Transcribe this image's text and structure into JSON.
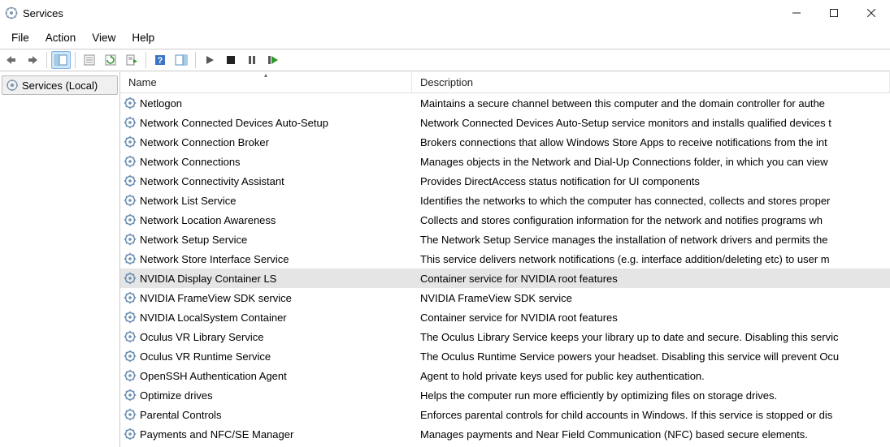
{
  "window": {
    "title": "Services"
  },
  "menubar": [
    "File",
    "Action",
    "View",
    "Help"
  ],
  "toolbar": [
    {
      "name": "nav-back-icon"
    },
    {
      "name": "nav-forward-icon"
    },
    {
      "sep": true
    },
    {
      "name": "show-hide-tree-icon",
      "active": true
    },
    {
      "sep": true
    },
    {
      "name": "properties-icon"
    },
    {
      "name": "refresh-icon"
    },
    {
      "name": "export-list-icon"
    },
    {
      "sep": true
    },
    {
      "name": "help-icon"
    },
    {
      "name": "show-hide-actions-icon"
    },
    {
      "sep": true
    },
    {
      "name": "start-service-icon"
    },
    {
      "name": "stop-service-icon"
    },
    {
      "name": "pause-service-icon"
    },
    {
      "name": "restart-service-icon"
    }
  ],
  "tree": {
    "root_label": "Services (Local)"
  },
  "columns": {
    "name": "Name",
    "description": "Description"
  },
  "selected_index": 9,
  "services": [
    {
      "name": "Netlogon",
      "desc": "Maintains a secure channel between this computer and the domain controller for authe"
    },
    {
      "name": "Network Connected Devices Auto-Setup",
      "desc": "Network Connected Devices Auto-Setup service monitors and installs qualified devices t"
    },
    {
      "name": "Network Connection Broker",
      "desc": "Brokers connections that allow Windows Store Apps to receive notifications from the int"
    },
    {
      "name": "Network Connections",
      "desc": "Manages objects in the Network and Dial-Up Connections folder, in which you can view"
    },
    {
      "name": "Network Connectivity Assistant",
      "desc": "Provides DirectAccess status notification for UI components"
    },
    {
      "name": "Network List Service",
      "desc": "Identifies the networks to which the computer has connected, collects and stores proper"
    },
    {
      "name": "Network Location Awareness",
      "desc": "Collects and stores configuration information for the network and notifies programs wh"
    },
    {
      "name": "Network Setup Service",
      "desc": "The Network Setup Service manages the installation of network drivers and permits the"
    },
    {
      "name": "Network Store Interface Service",
      "desc": "This service delivers network notifications (e.g. interface addition/deleting etc) to user m"
    },
    {
      "name": "NVIDIA Display Container LS",
      "desc": "Container service for NVIDIA root features"
    },
    {
      "name": "NVIDIA FrameView SDK service",
      "desc": "NVIDIA FrameView SDK service"
    },
    {
      "name": "NVIDIA LocalSystem Container",
      "desc": "Container service for NVIDIA root features"
    },
    {
      "name": "Oculus VR Library Service",
      "desc": "The Oculus Library Service keeps your library up to date and secure. Disabling this servic"
    },
    {
      "name": "Oculus VR Runtime Service",
      "desc": "The Oculus Runtime Service powers your headset. Disabling this service will prevent Ocu"
    },
    {
      "name": "OpenSSH Authentication Agent",
      "desc": "Agent to hold private keys used for public key authentication."
    },
    {
      "name": "Optimize drives",
      "desc": "Helps the computer run more efficiently by optimizing files on storage drives."
    },
    {
      "name": "Parental Controls",
      "desc": "Enforces parental controls for child accounts in Windows. If this service is stopped or dis"
    },
    {
      "name": "Payments and NFC/SE Manager",
      "desc": "Manages payments and Near Field Communication (NFC) based secure elements."
    }
  ]
}
